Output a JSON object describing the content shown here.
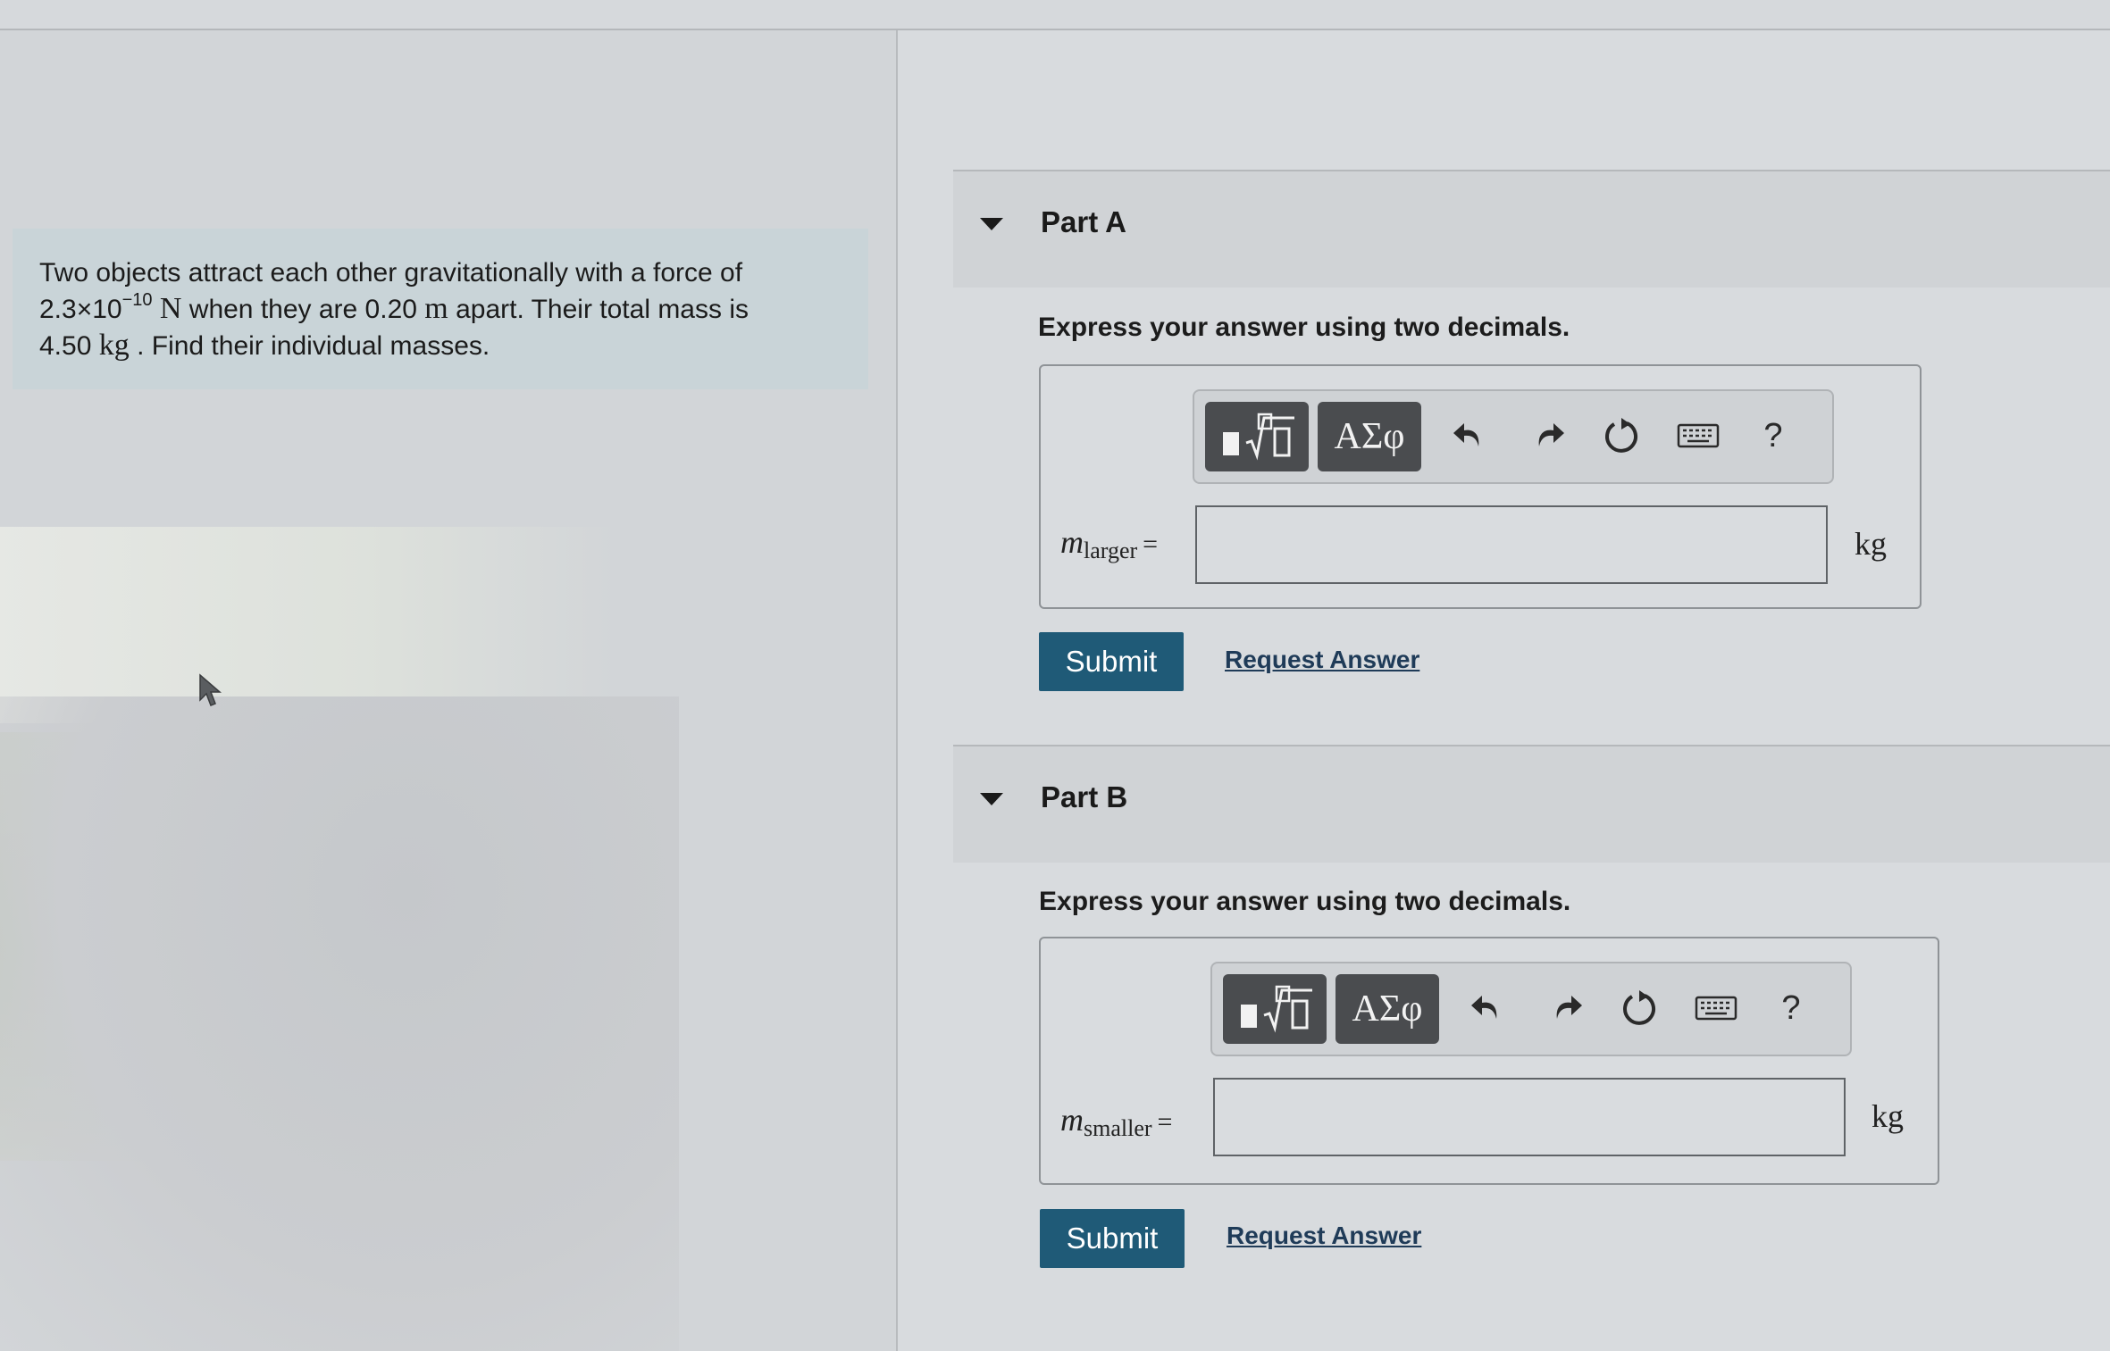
{
  "problem": {
    "text_1": "Two objects attract each other gravitationally with a force of",
    "force_coefficient": "2.3×10",
    "force_exponent": "−10",
    "force_unit": "N",
    "text_2": " when they are 0.20 ",
    "distance_unit": "m",
    "text_3": " apart. Their total mass is",
    "mass_value": "4.50 ",
    "mass_unit": "kg",
    "text_4": " . Find their individual masses."
  },
  "toolbar": {
    "template_icon": "fraction-root-template-icon",
    "greek_label": "ΑΣφ",
    "undo_icon": "undo-icon",
    "redo_icon": "redo-icon",
    "reset_icon": "reset-icon",
    "keyboard_icon": "keyboard-icon",
    "help_label": "?"
  },
  "parts": [
    {
      "title": "Part A",
      "instruction": "Express your answer using two decimals.",
      "variable": "m",
      "subscript": "larger",
      "equals": "=",
      "input_value": "",
      "unit": "kg",
      "submit_label": "Submit",
      "request_label": "Request Answer"
    },
    {
      "title": "Part B",
      "instruction": "Express your answer using two decimals.",
      "variable": "m",
      "subscript": "smaller",
      "equals": "=",
      "input_value": "",
      "unit": "kg",
      "submit_label": "Submit",
      "request_label": "Request Answer"
    }
  ],
  "colors": {
    "submit_bg": "#1f5a77",
    "toolbar_dark": "#4a4c4f",
    "problem_bg": "#c9d4d8"
  }
}
